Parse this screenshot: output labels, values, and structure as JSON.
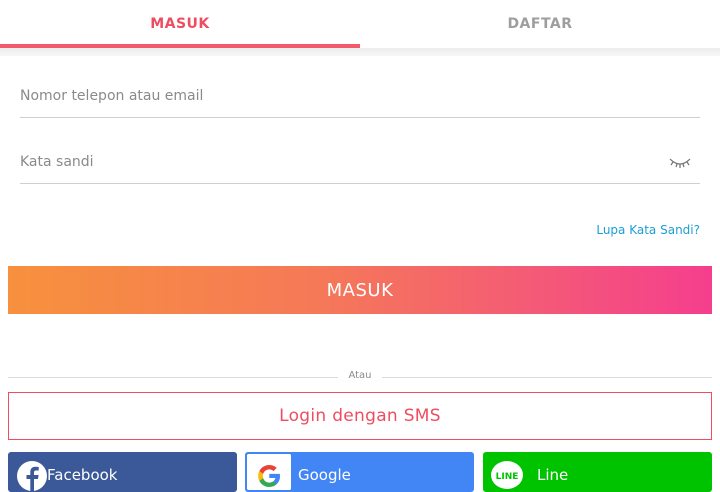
{
  "tabs": [
    {
      "label": "MASUK",
      "active": true
    },
    {
      "label": "DAFTAR",
      "active": false
    }
  ],
  "form": {
    "identifier_placeholder": "Nomor telepon atau email",
    "identifier_value": "",
    "password_placeholder": "Kata sandi",
    "password_value": "",
    "forgot_label": "Lupa Kata Sandi?",
    "submit_label": "MASUK"
  },
  "divider_text": "Atau",
  "sms_label": "Login dengan SMS",
  "social": {
    "facebook_label": "Facebook",
    "google_label": "Google",
    "line_label": "Line",
    "line_icon_text": "LINE"
  },
  "colors": {
    "accent": "#ee4d5f",
    "facebook": "#3b5998",
    "google": "#4285f4",
    "line": "#00c300",
    "link": "#1a9fd6"
  },
  "icons": {
    "password_toggle": "eye-closed-icon",
    "facebook": "facebook-icon",
    "google": "google-icon",
    "line": "line-icon"
  }
}
